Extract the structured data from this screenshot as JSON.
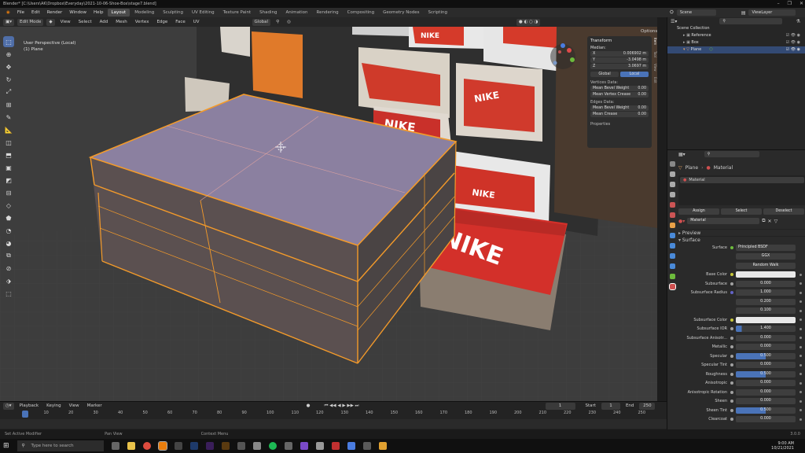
{
  "window": {
    "title": "Blender* [C:\\Users\\AK\\Dropbox\\Everyday\\2021-10-06-Shoe-Box\\stage7.blend]",
    "controls": [
      "–",
      "❐",
      "✕"
    ]
  },
  "menu": [
    "File",
    "Edit",
    "Render",
    "Window",
    "Help"
  ],
  "workspaces": [
    "Layout",
    "Modeling",
    "Sculpting",
    "UV Editing",
    "Texture Paint",
    "Shading",
    "Animation",
    "Rendering",
    "Compositing",
    "Geometry Nodes",
    "Scripting"
  ],
  "scene_header": {
    "scene": "Scene",
    "view_layer": "ViewLayer"
  },
  "viewport_header": {
    "mode": "Edit Mode",
    "menus": [
      "View",
      "Select",
      "Add",
      "Mesh",
      "Vertex",
      "Edge",
      "Face",
      "UV"
    ],
    "orientation": "Global",
    "options": "Options"
  },
  "viewport_info": {
    "line1": "User Perspective (Local)",
    "line2": "(1) Plane"
  },
  "box_text": [
    "NIKE",
    "NIKE",
    "NIKE",
    "NIKE",
    "NIKE"
  ],
  "npanel": {
    "tab": "Item",
    "section": "Transform",
    "median": "Median:",
    "x": {
      "label": "X",
      "value": "0.006902 m"
    },
    "y": {
      "label": "Y",
      "value": "-3.0498 m"
    },
    "z": {
      "label": "Z",
      "value": "3.0697 m"
    },
    "global": "Global",
    "local": "Local",
    "vertices_data": "Vertices Data:",
    "mean_bevel_weight_v": {
      "label": "Mean Bevel Weight",
      "value": "0.00"
    },
    "mean_vertex_crease": {
      "label": "Mean Vertex Crease",
      "value": "0.00"
    },
    "edges_data": "Edges Data:",
    "mean_bevel_weight_e": {
      "label": "Mean Bevel Weight",
      "value": "0.00"
    },
    "mean_crease": {
      "label": "Mean Crease",
      "value": "0.00"
    },
    "properties": "Properties"
  },
  "side_tabs": [
    "Item",
    "Tool",
    "View",
    "Edit"
  ],
  "outliner": {
    "items": [
      "Scene Collection",
      "Reference",
      "Box",
      "Plane"
    ],
    "selected": "Plane"
  },
  "properties": {
    "breadcrumb": [
      "Plane",
      "Material"
    ],
    "slot": "Material",
    "assign": "Assign",
    "select": "Select",
    "deselect": "Deselect",
    "material_name": "Material",
    "preview": "Preview",
    "surface_section": "Surface",
    "surface": {
      "label": "Surface",
      "value": "Principled BSDF"
    },
    "distribution": "GGX",
    "subsurface_method": "Random Walk",
    "rows": [
      {
        "label": "Base Color",
        "value": "",
        "kind": "color"
      },
      {
        "label": "Subsurface",
        "value": "0.000",
        "kind": "num"
      },
      {
        "label": "Subsurface Radius",
        "value": "1.000",
        "kind": "num"
      },
      {
        "label": "",
        "value": "0.200",
        "kind": "num"
      },
      {
        "label": "",
        "value": "0.100",
        "kind": "num"
      },
      {
        "label": "Subsurface Color",
        "value": "",
        "kind": "color"
      },
      {
        "label": "Subsurface IOR",
        "value": "1.400",
        "kind": "slider",
        "fill": 0.1
      },
      {
        "label": "Subsurface Anisotr...",
        "value": "0.000",
        "kind": "num"
      },
      {
        "label": "Metallic",
        "value": "0.000",
        "kind": "num"
      },
      {
        "label": "Specular",
        "value": "0.500",
        "kind": "slider",
        "fill": 0.5
      },
      {
        "label": "Specular Tint",
        "value": "0.000",
        "kind": "num"
      },
      {
        "label": "Roughness",
        "value": "0.500",
        "kind": "slider",
        "fill": 0.5
      },
      {
        "label": "Anisotropic",
        "value": "0.000",
        "kind": "num"
      },
      {
        "label": "Anisotropic Rotation",
        "value": "0.000",
        "kind": "num"
      },
      {
        "label": "Sheen",
        "value": "0.000",
        "kind": "num"
      },
      {
        "label": "Sheen Tint",
        "value": "0.500",
        "kind": "slider",
        "fill": 0.5
      },
      {
        "label": "Clearcoat",
        "value": "0.000",
        "kind": "num"
      }
    ]
  },
  "timeline": {
    "menus": [
      "Playback",
      "Keying",
      "View",
      "Marker"
    ],
    "current": "1",
    "start_label": "Start",
    "start": "1",
    "end_label": "End",
    "end": "250",
    "ticks": [
      "1",
      "10",
      "20",
      "30",
      "40",
      "50",
      "60",
      "70",
      "80",
      "90",
      "100",
      "110",
      "120",
      "130",
      "140",
      "150",
      "160",
      "170",
      "180",
      "190",
      "200",
      "210",
      "220",
      "230",
      "240",
      "250"
    ]
  },
  "status": [
    "Set Active Modifier",
    "Pan View",
    "Context Menu"
  ],
  "version": "3.0.0",
  "taskbar": {
    "search": "Type here to search",
    "time": "9:00 AM",
    "date": "10/21/2021"
  }
}
